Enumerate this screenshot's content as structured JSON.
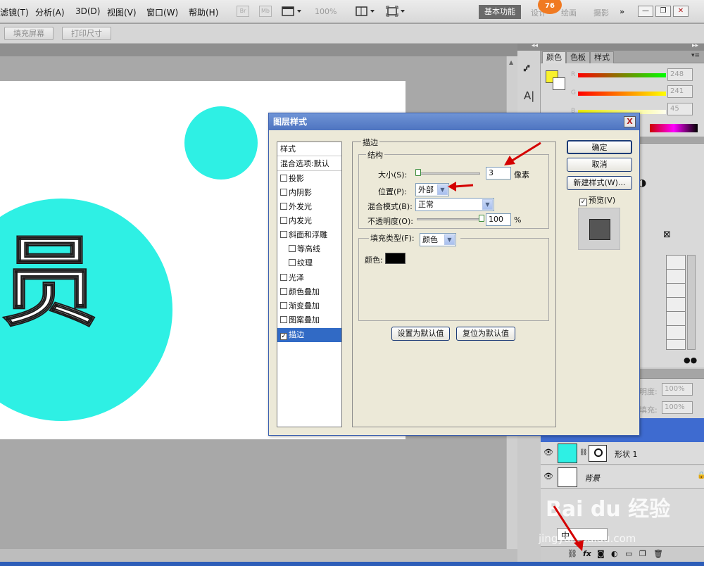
{
  "menubar": {
    "items": [
      "滤镜(T)",
      "分析(A)",
      "3D(D)",
      "视图(V)",
      "窗口(W)",
      "帮助(H)"
    ],
    "icons": [
      "Br",
      "Mb"
    ],
    "zoom": "100%",
    "workspace_active": "基本功能",
    "workspace_links": [
      "设计",
      "绘画",
      "摄影",
      "»"
    ],
    "badge": "76"
  },
  "optbar": {
    "buttons": [
      "填充屏幕",
      "打印尺寸"
    ]
  },
  "panels": {
    "color_tabs": [
      "颜色",
      "色板",
      "样式"
    ],
    "rgb": {
      "R": {
        "label": "R",
        "value": "248"
      },
      "G": {
        "label": "G",
        "value": "241"
      },
      "B": {
        "label": "B",
        "value": "45"
      }
    },
    "opacity_label": "明度:",
    "opacity_value": "100%",
    "fill_label": "填充:",
    "fill_value": "100%",
    "layers": [
      {
        "name": "形状 1"
      },
      {
        "name": "背景"
      }
    ],
    "ime_text": "中",
    "watermark_brand": "Bai du 经验",
    "watermark_url": "jingyan.baidu.com"
  },
  "dialog": {
    "title": "图层样式",
    "close": "X",
    "style_list": [
      {
        "label": "样式",
        "type": "header"
      },
      {
        "label": "混合选项:默认",
        "type": "header"
      },
      {
        "label": "投影",
        "type": "check",
        "checked": false
      },
      {
        "label": "内阴影",
        "type": "check",
        "checked": false
      },
      {
        "label": "外发光",
        "type": "check",
        "checked": false
      },
      {
        "label": "内发光",
        "type": "check",
        "checked": false
      },
      {
        "label": "斜面和浮雕",
        "type": "check",
        "checked": false
      },
      {
        "label": "等高线",
        "type": "subcheck",
        "checked": false
      },
      {
        "label": "纹理",
        "type": "subcheck",
        "checked": false
      },
      {
        "label": "光泽",
        "type": "check",
        "checked": false
      },
      {
        "label": "颜色叠加",
        "type": "check",
        "checked": false
      },
      {
        "label": "渐变叠加",
        "type": "check",
        "checked": false
      },
      {
        "label": "图案叠加",
        "type": "check",
        "checked": false
      },
      {
        "label": "描边",
        "type": "check",
        "checked": true
      }
    ],
    "stroke": {
      "title": "描边",
      "structure_title": "结构",
      "size_label": "大小(S):",
      "size_value": "3",
      "size_unit": "像素",
      "position_label": "位置(P):",
      "position_value": "外部",
      "blend_label": "混合模式(B):",
      "blend_value": "正常",
      "opacity_label": "不透明度(O):",
      "opacity_value": "100",
      "opacity_unit": "%",
      "fill_type_label": "填充类型(F):",
      "fill_type_value": "颜色",
      "color_label": "颜色:",
      "color": "#000000",
      "set_default": "设置为默认值",
      "reset_default": "复位为默认值"
    },
    "buttons": {
      "ok": "确定",
      "cancel": "取消",
      "new_style": "新建样式(W)...",
      "preview": "预览(V)"
    }
  },
  "canvas": {
    "glyph": "员",
    "shape_color": "#2ef0e4"
  }
}
